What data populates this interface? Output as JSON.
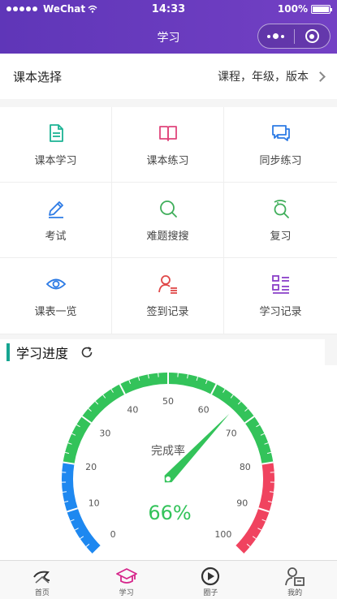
{
  "status": {
    "carrier": "WeChat",
    "time": "14:33",
    "battery": "100%"
  },
  "nav": {
    "title": "学习"
  },
  "book": {
    "label": "课本选择",
    "value": "课程，年级，版本"
  },
  "grid": [
    {
      "label": "课本学习",
      "icon": "document-icon",
      "color": "#1bb394"
    },
    {
      "label": "课本练习",
      "icon": "book-icon",
      "color": "#e0467c"
    },
    {
      "label": "同步练习",
      "icon": "chat-icon",
      "color": "#2d7be5"
    },
    {
      "label": "考试",
      "icon": "pencil-icon",
      "color": "#2d7be5"
    },
    {
      "label": "难题搜搜",
      "icon": "search-icon",
      "color": "#3fae5a"
    },
    {
      "label": "复习",
      "icon": "review-icon",
      "color": "#3fae5a"
    },
    {
      "label": "课表一览",
      "icon": "eye-icon",
      "color": "#2d7be5"
    },
    {
      "label": "签到记录",
      "icon": "user-list-icon",
      "color": "#e04848"
    },
    {
      "label": "学习记录",
      "icon": "record-list-icon",
      "color": "#8a3fc8"
    }
  ],
  "progress": {
    "title": "学习进度",
    "gauge_label": "完成率",
    "value_text": "66%",
    "value": 66,
    "ticks": [
      "0",
      "10",
      "20",
      "30",
      "40",
      "50",
      "60",
      "70",
      "80",
      "90",
      "100"
    ],
    "colors": {
      "low": "#1e88f0",
      "mid": "#33c35a",
      "high": "#f0435f",
      "value": "#33c35a"
    }
  },
  "tabs": [
    {
      "label": "首页",
      "icon": "home-icon"
    },
    {
      "label": "学习",
      "icon": "graduation-cap-icon"
    },
    {
      "label": "圈子",
      "icon": "play-circle-icon"
    },
    {
      "label": "我的",
      "icon": "profile-icon"
    }
  ]
}
